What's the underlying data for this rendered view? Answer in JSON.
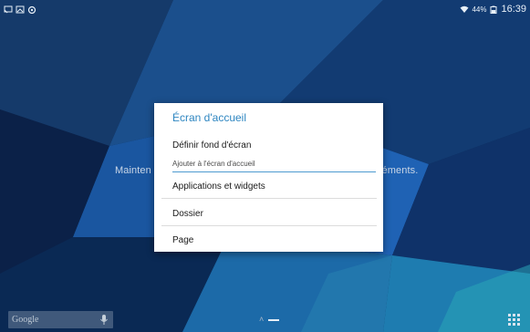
{
  "colors": {
    "accent": "#2e86c1",
    "dialog_bg": "#ffffff",
    "wallpaper_base": "#0e2a52"
  },
  "status_bar": {
    "left_icons": [
      "cast-icon",
      "image-icon",
      "gallery-icon"
    ],
    "right_icons": [
      "wifi-icon",
      "battery-icon"
    ],
    "battery_percent": "44%",
    "clock": "16:39"
  },
  "background_hint": {
    "left_fragment": "Mainten",
    "right_fragment": "léments."
  },
  "dialog": {
    "title": "Écran d'accueil",
    "items": [
      {
        "label": "Définir fond d'écran"
      },
      {
        "label": "Ajouter à l'écran d'accueil"
      },
      {
        "label": "Applications et widgets"
      },
      {
        "label": "Dossier"
      },
      {
        "label": "Page"
      }
    ]
  },
  "dock": {
    "search_hint": "Google",
    "search_icon": "mic-icon",
    "apps_icon": "apps-grid-icon"
  }
}
